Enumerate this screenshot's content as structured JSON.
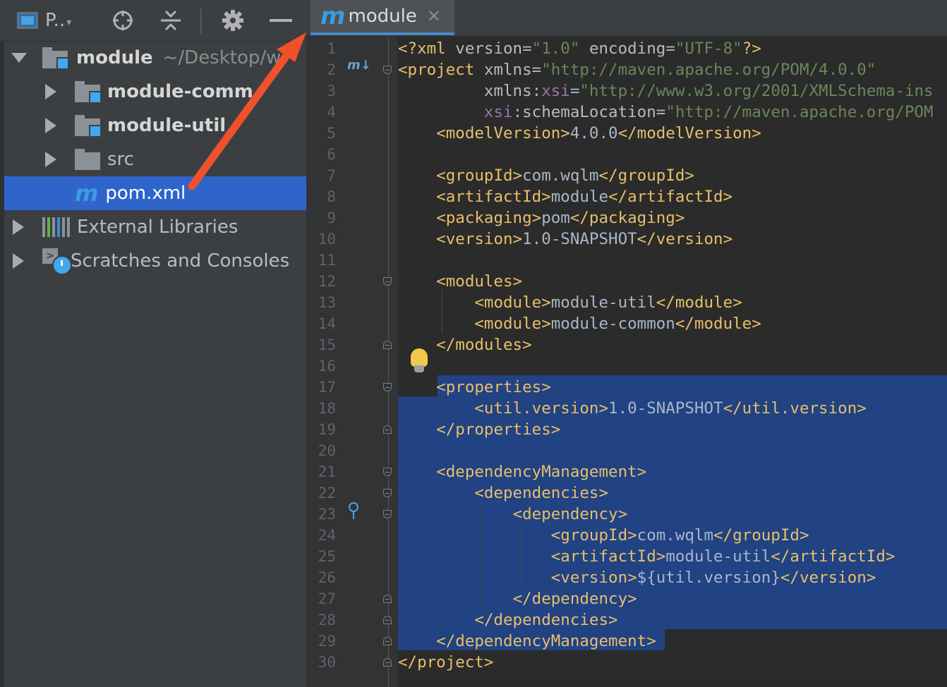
{
  "project_panel": {
    "view_label": "P..",
    "tree": [
      {
        "label": "module",
        "path": "~/Desktop/w",
        "expanded": true
      },
      {
        "label": "module-comm",
        "expanded": false
      },
      {
        "label": "module-util",
        "expanded": false
      },
      {
        "label": "src",
        "expanded": false
      },
      {
        "label": "pom.xml",
        "selected": true
      },
      {
        "label": "External Libraries",
        "expanded": false
      },
      {
        "label": "Scratches and Consoles",
        "expanded": false
      }
    ]
  },
  "editor": {
    "tab": {
      "label": "module",
      "close": "✕"
    },
    "line_numbers": [
      "1",
      "2",
      "3",
      "4",
      "5",
      "6",
      "7",
      "8",
      "9",
      "10",
      "11",
      "12",
      "13",
      "14",
      "15",
      "16",
      "17",
      "18",
      "19",
      "20",
      "21",
      "22",
      "23",
      "24",
      "25",
      "26",
      "27",
      "28",
      "29",
      "30"
    ],
    "code": [
      [
        [
          "t",
          "<?xml "
        ],
        [
          "an",
          "version"
        ],
        [
          "tx",
          "="
        ],
        [
          "av",
          "\"1.0\""
        ],
        [
          "tx",
          " "
        ],
        [
          "an",
          "encoding"
        ],
        [
          "tx",
          "="
        ],
        [
          "av",
          "\"UTF-8\""
        ],
        [
          "t",
          "?>"
        ]
      ],
      [
        [
          "t",
          "<project "
        ],
        [
          "an",
          "xmlns"
        ],
        [
          "tx",
          "="
        ],
        [
          "av",
          "\"http://maven.apache.org/POM/4.0.0\""
        ]
      ],
      [
        [
          "tx",
          "         "
        ],
        [
          "an",
          "xmlns"
        ],
        [
          "tx",
          ":"
        ],
        [
          "ns",
          "xsi"
        ],
        [
          "tx",
          "="
        ],
        [
          "av",
          "\"http://www.w3.org/2001/XMLSchema-ins"
        ]
      ],
      [
        [
          "tx",
          "         "
        ],
        [
          "ns",
          "xsi"
        ],
        [
          "tx",
          ":"
        ],
        [
          "an",
          "schemaLocation"
        ],
        [
          "tx",
          "="
        ],
        [
          "av",
          "\"http://maven.apache.org/POM"
        ]
      ],
      [
        [
          "tx",
          "    "
        ],
        [
          "t",
          "<modelVersion>"
        ],
        [
          "tx",
          "4.0.0"
        ],
        [
          "t",
          "</modelVersion>"
        ]
      ],
      [
        [
          "tx",
          ""
        ]
      ],
      [
        [
          "tx",
          "    "
        ],
        [
          "t",
          "<groupId>"
        ],
        [
          "tx",
          "com.wqlm"
        ],
        [
          "t",
          "</groupId>"
        ]
      ],
      [
        [
          "tx",
          "    "
        ],
        [
          "t",
          "<artifactId>"
        ],
        [
          "tx",
          "module"
        ],
        [
          "t",
          "</artifactId>"
        ]
      ],
      [
        [
          "tx",
          "    "
        ],
        [
          "t",
          "<packaging>"
        ],
        [
          "tx",
          "pom"
        ],
        [
          "t",
          "</packaging>"
        ]
      ],
      [
        [
          "tx",
          "    "
        ],
        [
          "t",
          "<version>"
        ],
        [
          "tx",
          "1.0-SNAPSHOT"
        ],
        [
          "t",
          "</version>"
        ]
      ],
      [
        [
          "tx",
          ""
        ]
      ],
      [
        [
          "tx",
          "    "
        ],
        [
          "t",
          "<modules>"
        ]
      ],
      [
        [
          "tx",
          "        "
        ],
        [
          "t",
          "<module>"
        ],
        [
          "tx",
          "module-util"
        ],
        [
          "t",
          "</module>"
        ]
      ],
      [
        [
          "tx",
          "        "
        ],
        [
          "t",
          "<module>"
        ],
        [
          "tx",
          "module-common"
        ],
        [
          "t",
          "</module>"
        ]
      ],
      [
        [
          "tx",
          "    "
        ],
        [
          "t",
          "</modules>"
        ]
      ],
      [
        [
          "tx",
          ""
        ]
      ],
      [
        [
          "tx",
          "    "
        ],
        [
          "t",
          "<properties>"
        ]
      ],
      [
        [
          "tx",
          "        "
        ],
        [
          "t",
          "<util.version>"
        ],
        [
          "tx",
          "1.0-SNAPSHOT"
        ],
        [
          "t",
          "</util.version>"
        ]
      ],
      [
        [
          "tx",
          "    "
        ],
        [
          "t",
          "</properties>"
        ]
      ],
      [
        [
          "tx",
          ""
        ]
      ],
      [
        [
          "tx",
          "    "
        ],
        [
          "t",
          "<dependencyManagement>"
        ]
      ],
      [
        [
          "tx",
          "        "
        ],
        [
          "t",
          "<dependencies>"
        ]
      ],
      [
        [
          "tx",
          "            "
        ],
        [
          "t",
          "<dependency>"
        ]
      ],
      [
        [
          "tx",
          "                "
        ],
        [
          "t",
          "<groupId>"
        ],
        [
          "tx",
          "com.wqlm"
        ],
        [
          "t",
          "</groupId>"
        ]
      ],
      [
        [
          "tx",
          "                "
        ],
        [
          "t",
          "<artifactId>"
        ],
        [
          "tx",
          "module-util"
        ],
        [
          "t",
          "</artifactId>"
        ]
      ],
      [
        [
          "tx",
          "                "
        ],
        [
          "t",
          "<version>"
        ],
        [
          "tx",
          "${util.version}"
        ],
        [
          "t",
          "</version>"
        ]
      ],
      [
        [
          "tx",
          "            "
        ],
        [
          "t",
          "</dependency>"
        ]
      ],
      [
        [
          "tx",
          "        "
        ],
        [
          "t",
          "</dependencies>"
        ]
      ],
      [
        [
          "tx",
          "    "
        ],
        [
          "t",
          "</dependencyManagement>"
        ]
      ],
      [
        [
          "t",
          "</project>"
        ]
      ]
    ]
  },
  "colors": {
    "selection": "#214283",
    "tree_selection": "#2f65ca",
    "tag": "#e8bf6a",
    "attr_value": "#6a8759",
    "namespace": "#9876aa",
    "arrow": "#f0512b"
  }
}
